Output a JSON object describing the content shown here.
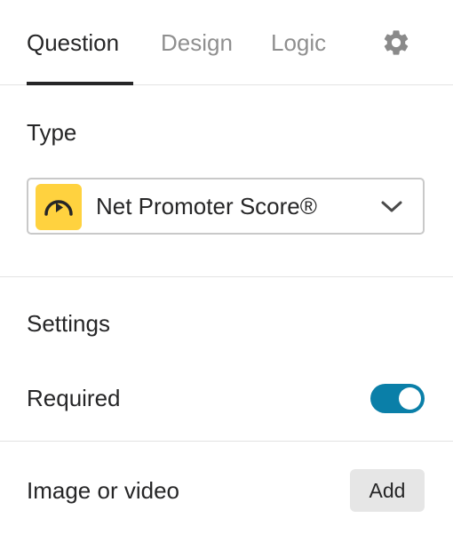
{
  "tabs": [
    {
      "label": "Question",
      "active": true
    },
    {
      "label": "Design",
      "active": false
    },
    {
      "label": "Logic",
      "active": false
    }
  ],
  "settings_icon": "gear-icon",
  "type_section": {
    "heading": "Type",
    "selected_type": "Net Promoter Score®",
    "type_icon": "gauge-icon",
    "type_icon_color": "#ffd23f"
  },
  "settings_section": {
    "heading": "Settings",
    "required": {
      "label": "Required",
      "enabled": true,
      "toggle_color": "#0a7fa8"
    }
  },
  "media_section": {
    "label": "Image or video",
    "add_label": "Add"
  }
}
